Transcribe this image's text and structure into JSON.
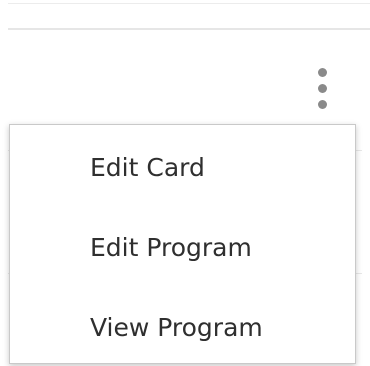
{
  "card_menu": {
    "trigger_icon": "vertical-ellipsis-icon",
    "items": [
      {
        "label": "Edit Card"
      },
      {
        "label": "Edit Program"
      },
      {
        "label": "View Program"
      }
    ]
  }
}
